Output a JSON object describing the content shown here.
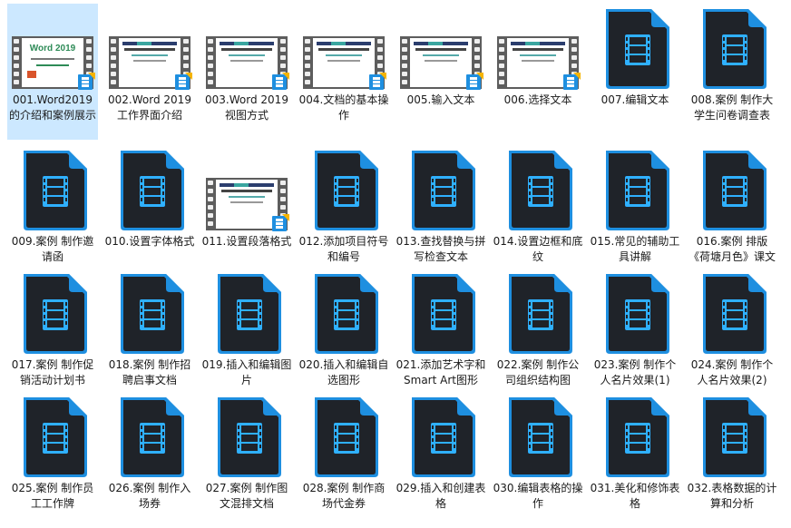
{
  "items": [
    {
      "label": "001.Word2019的介绍和案例展示",
      "thumb": "word-cover",
      "selected": true
    },
    {
      "label": "002.Word 2019工作界面介绍",
      "thumb": "slide"
    },
    {
      "label": "003.Word 2019视图方式",
      "thumb": "slide"
    },
    {
      "label": "004.文档的基本操作",
      "thumb": "slide"
    },
    {
      "label": "005.输入文本",
      "thumb": "slide"
    },
    {
      "label": "006.选择文本",
      "thumb": "slide"
    },
    {
      "label": "007.编辑文本",
      "thumb": "icon"
    },
    {
      "label": "008.案例 制作大学生问卷调查表",
      "thumb": "icon"
    },
    {
      "label": "009.案例 制作邀请函",
      "thumb": "icon"
    },
    {
      "label": "010.设置字体格式",
      "thumb": "icon"
    },
    {
      "label": "011.设置段落格式",
      "thumb": "slide"
    },
    {
      "label": "012.添加项目符号和编号",
      "thumb": "icon"
    },
    {
      "label": "013.查找替换与拼写检查文本",
      "thumb": "icon"
    },
    {
      "label": "014.设置边框和底纹",
      "thumb": "icon"
    },
    {
      "label": "015.常见的辅助工具讲解",
      "thumb": "icon"
    },
    {
      "label": "016.案例 排版《荷塘月色》课文",
      "thumb": "icon"
    },
    {
      "label": "017.案例 制作促销活动计划书",
      "thumb": "icon"
    },
    {
      "label": "018.案例 制作招聘启事文档",
      "thumb": "icon"
    },
    {
      "label": "019.插入和编辑图片",
      "thumb": "icon"
    },
    {
      "label": "020.插入和编辑自选图形",
      "thumb": "icon"
    },
    {
      "label": "021.添加艺术字和Smart Art图形",
      "thumb": "icon"
    },
    {
      "label": "022.案例 制作公司组织结构图",
      "thumb": "icon"
    },
    {
      "label": "023.案例 制作个人名片效果(1)",
      "thumb": "icon"
    },
    {
      "label": "024.案例 制作个人名片效果(2)",
      "thumb": "icon"
    },
    {
      "label": "025.案例 制作员工工作牌",
      "thumb": "icon"
    },
    {
      "label": "026.案例 制作入场券",
      "thumb": "icon"
    },
    {
      "label": "027.案例 制作图文混排文档",
      "thumb": "icon"
    },
    {
      "label": "028.案例 制作商场代金券",
      "thumb": "icon"
    },
    {
      "label": "029.插入和创建表格",
      "thumb": "icon"
    },
    {
      "label": "030.编辑表格的操作",
      "thumb": "icon"
    },
    {
      "label": "031.美化和修饰表格",
      "thumb": "icon"
    },
    {
      "label": "032.表格数据的计算和分析",
      "thumb": "icon"
    }
  ],
  "cover": {
    "title": "Word 2019"
  },
  "colors": {
    "selection": "#cce8ff",
    "icon_body": "#1f2329",
    "icon_accent": "#1e8fe0",
    "icon_glyph": "#2fb0ff"
  },
  "icons": {
    "file": "video-file-icon",
    "overlay": "video-overlay-icon"
  }
}
